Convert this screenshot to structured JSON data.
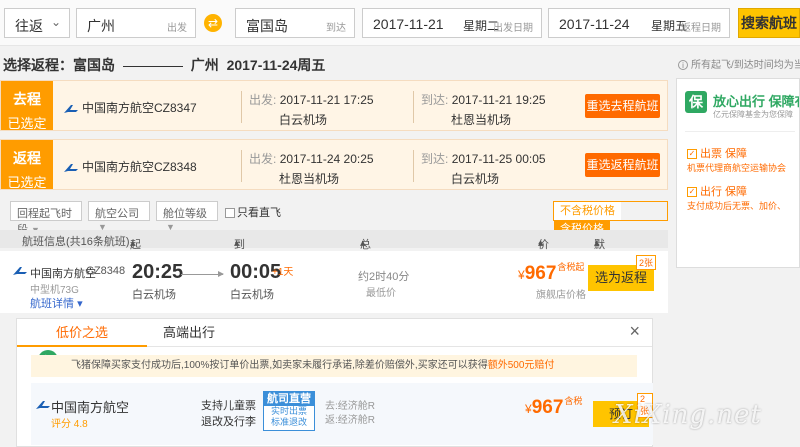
{
  "search": {
    "trip_type": "往返",
    "from_city": "广州",
    "from_suffix": "出发",
    "to_city": "富国岛",
    "to_suffix": "到达",
    "depart_date": "2017-11-21",
    "depart_weekday": "星期二",
    "depart_suffix": "出发日期",
    "return_date": "2017-11-24",
    "return_weekday": "星期五",
    "return_suffix": "返程日期",
    "search_button": "搜索航班"
  },
  "route_header": {
    "prefix": "选择返程：富国岛",
    "dest": "广州",
    "date": "2017-11-24周五"
  },
  "outbound": {
    "tag_a": "去程",
    "tag_b": "已选定",
    "airline": "中国南方航空CZ8347",
    "dep_label": "出发:",
    "dep_time": "2017-11-21 17:25",
    "dep_airport": "白云机场",
    "arr_label": "到达:",
    "arr_time": "2017-11-21 19:25",
    "arr_airport": "杜恩当机场",
    "button": "重选去程航班"
  },
  "return_leg": {
    "tag_a": "返程",
    "tag_b": "已选定",
    "airline": "中国南方航空CZ8348",
    "dep_label": "出发:",
    "dep_time": "2017-11-24 20:25",
    "dep_airport": "杜恩当机场",
    "arr_label": "到达:",
    "arr_time": "2017-11-25 00:05",
    "arr_airport": "白云机场",
    "button": "重选返程航班"
  },
  "filters": {
    "f1": "回程起飞时段",
    "f2": "航空公司",
    "f3": "舱位等级",
    "direct": "只看直飞",
    "price_excl": "不含税价格",
    "price_incl": "含税价格"
  },
  "table_header": {
    "info": "航班信息(共16条航班)",
    "dep": "起飞时间",
    "arr": "到达时间",
    "dur": "总耗时",
    "price": "价格",
    "sort": "默认排序"
  },
  "flight": {
    "airline": "中国南方航空",
    "code": "CZ8348",
    "plane": "中型机73G",
    "detail_link": "航班详情",
    "dep_time": "20:25",
    "dep_airport": "白云机场",
    "arr_time": "00:05",
    "plus_day": "+1天",
    "arr_airport": "白云机场",
    "duration": "约2时40分",
    "lowest": "最低价",
    "currency": "¥",
    "price": "967",
    "price_unit": "含税起",
    "price_note": "旗舰店价格",
    "button": "选为返程",
    "count": "2张"
  },
  "panel": {
    "tab1": "低价之选",
    "tab2": "高端出行",
    "close_icon": "×",
    "notice": "飞猪保障买家支付成功后,100%按订单价出票,如卖家未履行承诺,除差价赔偿外,买家还可以获得",
    "notice_highlight": "额外500元赔付",
    "airline": "中国南方航空",
    "score": "评分 4.8",
    "feat1": "支持儿童票",
    "feat2": "退改及行李",
    "badge_title": "航司直营",
    "badge_l1": "实时出票",
    "badge_l2": "标准退改",
    "econ1": "去:经济舱R",
    "econ2": "返:经济舱R",
    "currency": "¥",
    "price": "967",
    "price_unit": "含税",
    "button": "预订",
    "count": "2张"
  },
  "sidebar": {
    "note": "所有起飞/到达时间均为当",
    "title": "放心出行 保障有",
    "subtitle": "亿元保障基金为您保障",
    "h1": "出票 保障",
    "d1": "机票代理商航空运输协会",
    "h2": "出行 保障",
    "d2": "支付成功后无票、加价、"
  },
  "watermark": "XiXing.net",
  "colors": {
    "accent": "#ff9c00",
    "button_orange": "#ff6a00",
    "search_yellow": "#ffc400",
    "link_blue": "#3366cc",
    "safe_green": "#2fa862"
  }
}
